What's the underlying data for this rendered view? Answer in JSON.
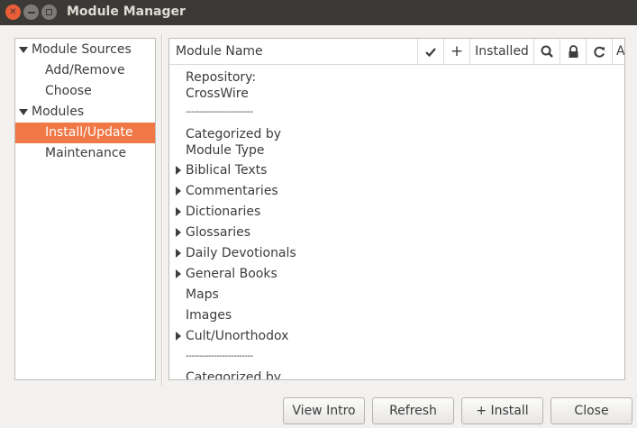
{
  "window": {
    "title": "Module Manager"
  },
  "sidebar": {
    "items": [
      {
        "label": "Module Sources",
        "expanded": true
      },
      {
        "label": "Add/Remove"
      },
      {
        "label": "Choose"
      },
      {
        "label": "Modules",
        "expanded": true
      },
      {
        "label": "Install/Update",
        "selected": true
      },
      {
        "label": "Maintenance"
      }
    ]
  },
  "table": {
    "headers": {
      "module_name": "Module Name",
      "check_icon": "checkmark-icon",
      "plus": "+",
      "installed": "Installed",
      "search_icon": "search-icon",
      "lock_icon": "lock-icon",
      "refresh_icon": "refresh-icon",
      "overflow": "A"
    },
    "rows": [
      {
        "line1": "Repository:",
        "line2": "CrossWire"
      },
      {
        "label": "------------------------"
      },
      {
        "line1": "Categorized by",
        "line2": "Module Type"
      },
      {
        "label": "Biblical Texts",
        "expandable": true
      },
      {
        "label": "Commentaries",
        "expandable": true
      },
      {
        "label": "Dictionaries",
        "expandable": true
      },
      {
        "label": "Glossaries",
        "expandable": true
      },
      {
        "label": "Daily Devotionals",
        "expandable": true
      },
      {
        "label": "General Books",
        "expandable": true
      },
      {
        "label": "Maps"
      },
      {
        "label": "Images"
      },
      {
        "label": "Cult/Unorthodox",
        "expandable": true
      },
      {
        "label": "------------------------"
      },
      {
        "label": "Categorized by"
      }
    ]
  },
  "buttons": {
    "view_intro": "View Intro",
    "refresh": "Refresh",
    "install": "+ Install",
    "close": "Close"
  },
  "colors": {
    "accent": "#f07746",
    "titlebar": "#3b3a36",
    "close": "#e95e38"
  }
}
